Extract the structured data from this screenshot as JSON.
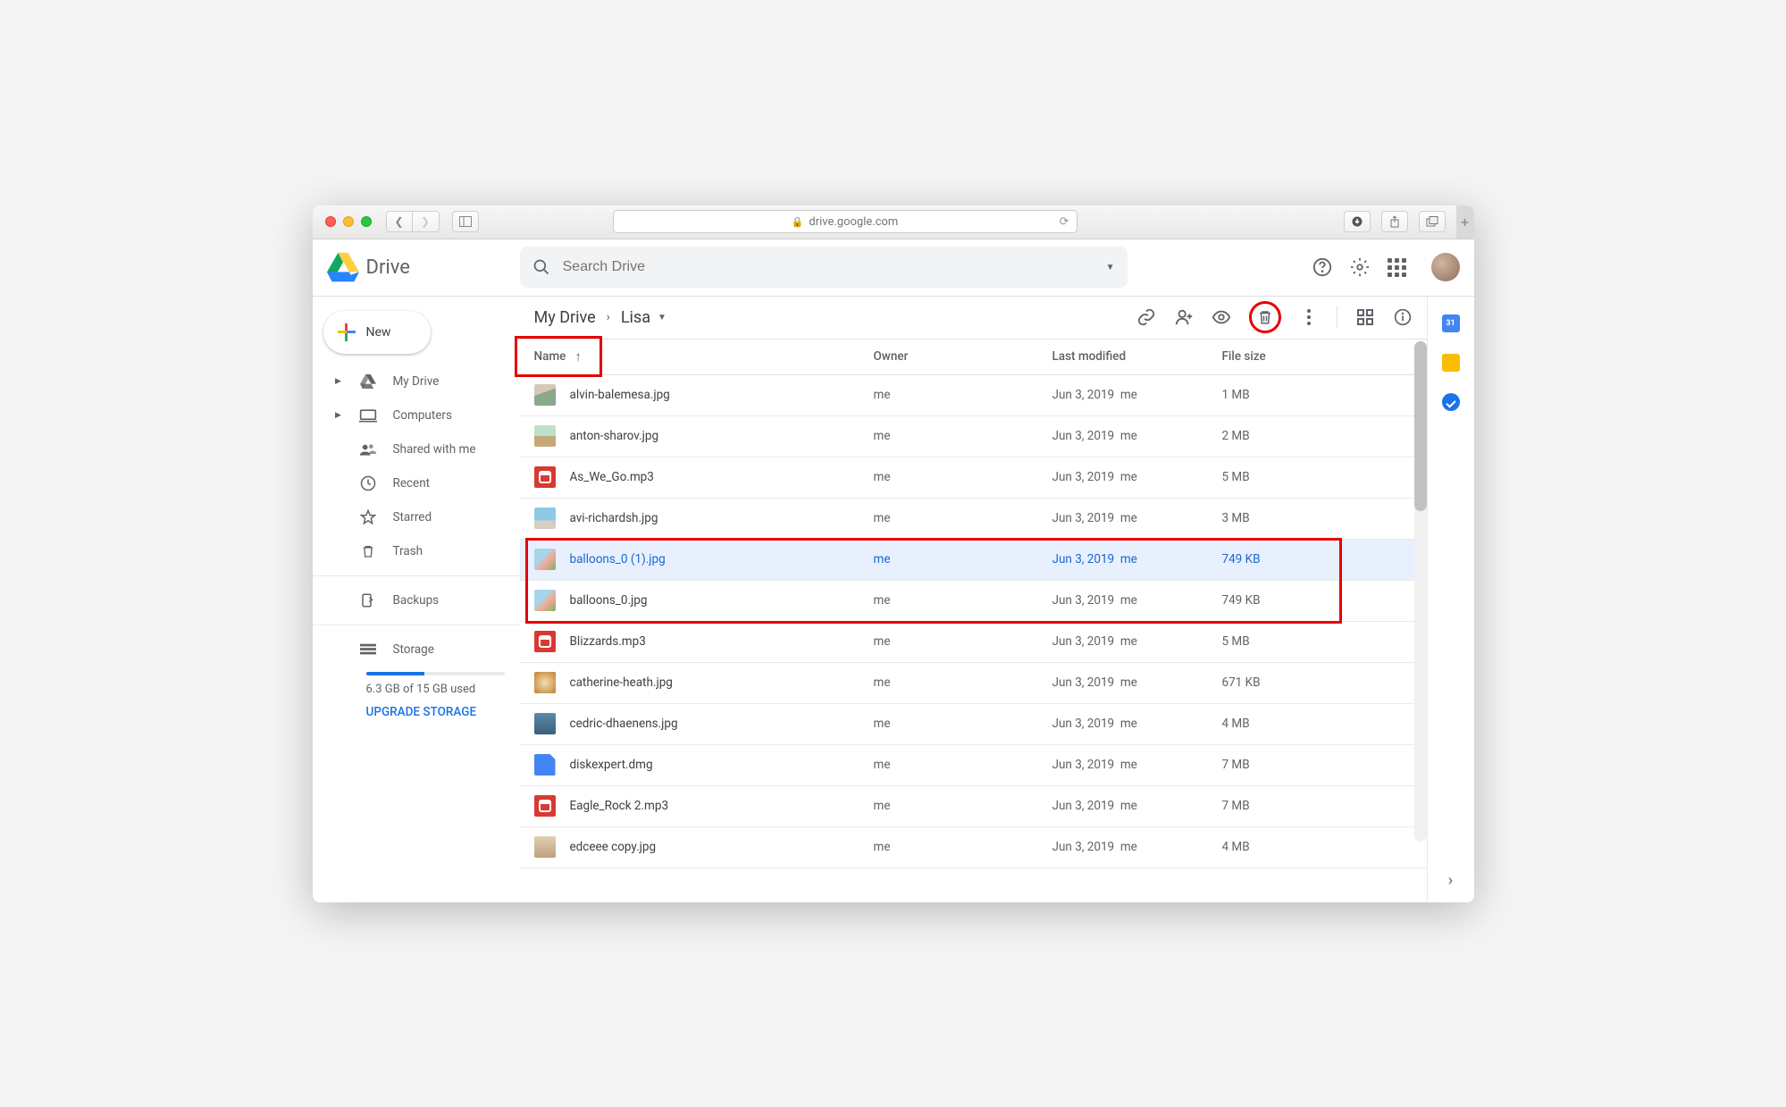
{
  "browser": {
    "url_display": "drive.google.com"
  },
  "header": {
    "product": "Drive",
    "search_placeholder": "Search Drive"
  },
  "sidebar": {
    "new_label": "New",
    "items": [
      {
        "label": "My Drive",
        "expandable": true
      },
      {
        "label": "Computers",
        "expandable": true
      },
      {
        "label": "Shared with me",
        "expandable": false
      },
      {
        "label": "Recent",
        "expandable": false
      },
      {
        "label": "Starred",
        "expandable": false
      },
      {
        "label": "Trash",
        "expandable": false
      }
    ],
    "backups_label": "Backups",
    "storage_label": "Storage",
    "storage_used": "6.3 GB of 15 GB used",
    "upgrade_label": "UPGRADE STORAGE"
  },
  "breadcrumb": {
    "root": "My Drive",
    "current": "Lisa"
  },
  "columns": {
    "name": "Name",
    "owner": "Owner",
    "modified": "Last modified",
    "size": "File size"
  },
  "files": [
    {
      "name": "alvin-balemesa.jpg",
      "owner": "me",
      "modified": "Jun 3, 2019",
      "modified_by": "me",
      "size": "1 MB",
      "thumb": "img1"
    },
    {
      "name": "anton-sharov.jpg",
      "owner": "me",
      "modified": "Jun 3, 2019",
      "modified_by": "me",
      "size": "2 MB",
      "thumb": "img2"
    },
    {
      "name": "As_We_Go.mp3",
      "owner": "me",
      "modified": "Jun 3, 2019",
      "modified_by": "me",
      "size": "5 MB",
      "thumb": "audio"
    },
    {
      "name": "avi-richardsh.jpg",
      "owner": "me",
      "modified": "Jun 3, 2019",
      "modified_by": "me",
      "size": "3 MB",
      "thumb": "img3"
    },
    {
      "name": "balloons_0 (1).jpg",
      "owner": "me",
      "modified": "Jun 3, 2019",
      "modified_by": "me",
      "size": "749 KB",
      "thumb": "img4",
      "selected": true
    },
    {
      "name": "balloons_0.jpg",
      "owner": "me",
      "modified": "Jun 3, 2019",
      "modified_by": "me",
      "size": "749 KB",
      "thumb": "img5"
    },
    {
      "name": "Blizzards.mp3",
      "owner": "me",
      "modified": "Jun 3, 2019",
      "modified_by": "me",
      "size": "5 MB",
      "thumb": "audio"
    },
    {
      "name": "catherine-heath.jpg",
      "owner": "me",
      "modified": "Jun 3, 2019",
      "modified_by": "me",
      "size": "671 KB",
      "thumb": "img6"
    },
    {
      "name": "cedric-dhaenens.jpg",
      "owner": "me",
      "modified": "Jun 3, 2019",
      "modified_by": "me",
      "size": "4 MB",
      "thumb": "img7"
    },
    {
      "name": "diskexpert.dmg",
      "owner": "me",
      "modified": "Jun 3, 2019",
      "modified_by": "me",
      "size": "7 MB",
      "thumb": "file"
    },
    {
      "name": "Eagle_Rock 2.mp3",
      "owner": "me",
      "modified": "Jun 3, 2019",
      "modified_by": "me",
      "size": "7 MB",
      "thumb": "audio"
    },
    {
      "name": "edceee copy.jpg",
      "owner": "me",
      "modified": "Jun 3, 2019",
      "modified_by": "me",
      "size": "4 MB",
      "thumb": "img8"
    }
  ],
  "annotations": {
    "highlight_name_header": true,
    "highlight_trash_button": true,
    "highlight_duplicate_rows": [
      4,
      5
    ]
  }
}
